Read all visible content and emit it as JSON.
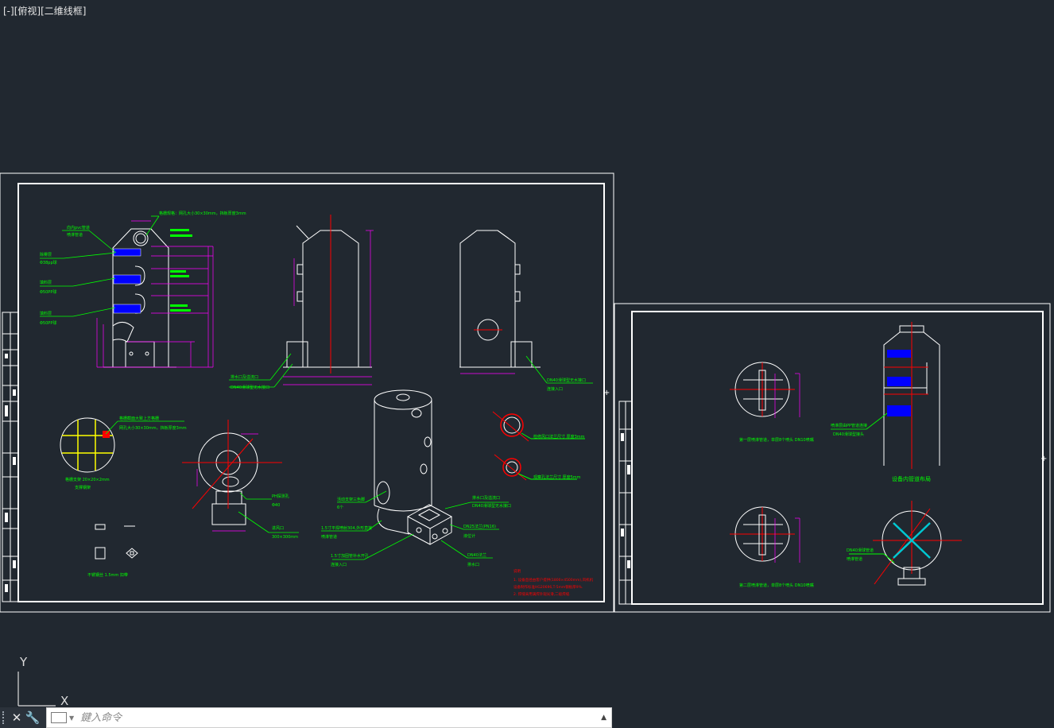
{
  "viewport": {
    "minus": "[-]",
    "view": "[俯视]",
    "style": "[二维线框]"
  },
  "sheet1": {
    "grid_note1": "格栅规格：网孔大小30×30mm，挡板厚度3mm",
    "pvc_note": "向内pvc管道",
    "pvc_note2": "喷淋管道",
    "layer1": "除雾层",
    "layer1b": "Φ38pp球",
    "layer2": "填料层",
    "layer2b": "Φ50PP球",
    "layer3": "填料层",
    "layer3b": "Φ50PP球",
    "drain_note": "排水口及溢流口",
    "drain_note2": "DN40滑球型无水接口",
    "dn40_note": "DN40滑球型无水接口",
    "dn40_note2": "连接入口",
    "grid_title": "格栅截面大致上方格栅",
    "grid_spec": "网孔大小30×30mm，挡板厚度3mm",
    "grid_plate": "格栅支架 20×20×2mm",
    "grid_plate2": "支撑钢架",
    "ph_note": "PH探测孔",
    "ph_size": "Φ40",
    "inlet_note": "进风口",
    "inlet_size": "300×300mm",
    "hole_note1": "检修风口法兰尺寸 厚度3mm",
    "hole_note2": "观察孔法兰尺寸 厚度5mm",
    "access_note": "活动支架三色脚",
    "access_qty": "6个",
    "pipe_note": "1.5寸平焊喷射304,外形直接",
    "pipe_note2": "喷淋管道",
    "tank_note": "排水口及溢流口",
    "tank_note2": "DN40滑球型无水接口",
    "valve_note": "DN25法兰(PN16)",
    "valve_note2": "液位计",
    "inlet_pipe": "1.5寸加固管补水开孔",
    "inlet_pipe2": "连接入口",
    "drain_dn40": "DN40法兰",
    "drain_dn40b": "排水口",
    "bolt_note": "不锈钢丝 1.5mm 扣带",
    "notes_title": "说明",
    "notes": [
      "1. 设备直径由客户提供(1800×4500mm),风机机",
      "  设备制作标准HG20696,T-5mm钢板厚9%.",
      "2. 焊缝采用满焊外观光滑,二级焊缝."
    ]
  },
  "sheet2": {
    "layer1_caption": "第一层喷淋管道，单层8个喷头 DN10喷嘴",
    "layer2_caption": "第二层喷淋管道，单层8个喷头 DN10喷嘴",
    "title": "设备内管道布局",
    "spray_note": "喷淋层由PP管道连接",
    "spray_note2": "DN40滑球型接头",
    "bottom_note": "DN40滑球管道",
    "bottom_note2": "喷淋管道"
  },
  "ucs": {
    "y": "Y",
    "x": "X"
  },
  "commandline": {
    "placeholder": "鍵入命令"
  },
  "colors": {
    "background": "#212830",
    "line": "#ffffff",
    "dim": "#ff00ff",
    "text": "#00ff00",
    "red": "#ff0000",
    "blue": "#0000ff",
    "yellow": "#ffff00",
    "cyan": "#00c8d2"
  }
}
